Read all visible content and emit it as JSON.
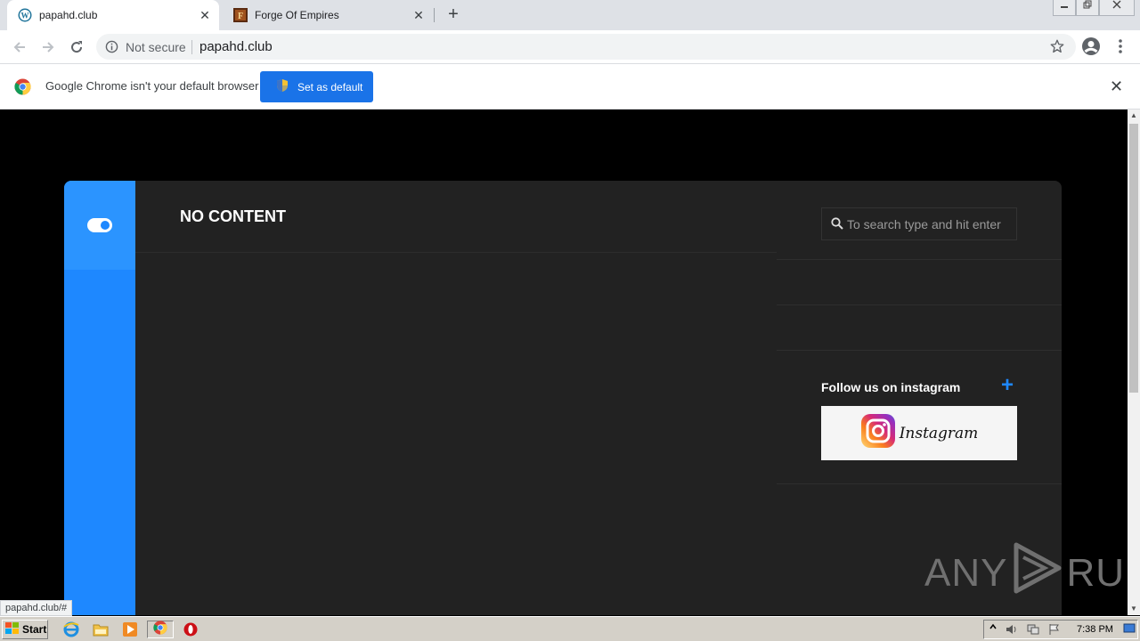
{
  "browser": {
    "tabs": [
      {
        "title": "papahd.club",
        "favicon": "wordpress-icon",
        "active": true
      },
      {
        "title": "Forge Of Empires",
        "favicon": "forge-of-empires-icon",
        "active": false
      }
    ],
    "new_tab_label": "+",
    "tab_close_glyph": "✕",
    "window_controls": [
      "minimize",
      "restore",
      "close"
    ],
    "omnibox": {
      "security_label": "Not secure",
      "url": "papahd.club"
    }
  },
  "infobar": {
    "message": "Google Chrome isn't your default browser",
    "button_label": "Set as default",
    "close_glyph": "✕"
  },
  "page": {
    "heading": "NO CONTENT",
    "search": {
      "placeholder": "To search type and hit enter",
      "value": ""
    },
    "instagram_widget": {
      "title": "Follow us on instagram",
      "plus": "+",
      "banner_text": "Instagram"
    },
    "accent_color": "#1e88ff",
    "card_color": "#222222"
  },
  "status_bar": {
    "url": "papahd.club/#"
  },
  "watermark": {
    "left": "ANY",
    "right": "RUN"
  },
  "taskbar": {
    "start_label": "Start",
    "clock": "7:38 PM",
    "pinned": [
      "internet-explorer-icon",
      "folder-icon",
      "media-player-icon",
      "chrome-icon",
      "opera-icon"
    ]
  }
}
